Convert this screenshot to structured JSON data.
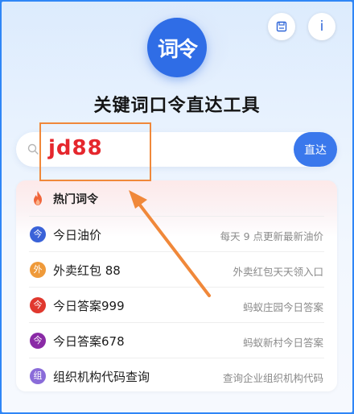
{
  "logo": {
    "text": "词令"
  },
  "top_buttons": {
    "save_icon": "save-icon",
    "info_label": "i"
  },
  "title": "关键词口令直达工具",
  "search": {
    "value": "jd88",
    "icon": "search-icon",
    "go_label": "直达"
  },
  "hot": {
    "title": "热门词令",
    "icon": "fire-icon",
    "accent": "#f0883a",
    "items": [
      {
        "badge": "今",
        "badge_color": "#3a62d8",
        "name": "今日油价",
        "desc": "每天 9 点更新最新油价"
      },
      {
        "badge": "外",
        "badge_color": "#ef9a3a",
        "name": "外卖红包 88",
        "desc": "外卖红包天天领入口"
      },
      {
        "badge": "今",
        "badge_color": "#e0382e",
        "name": "今日答案999",
        "desc": "蚂蚁庄园今日答案"
      },
      {
        "badge": "今",
        "badge_color": "#8a2aa6",
        "name": "今日答案678",
        "desc": "蚂蚁新村今日答案"
      },
      {
        "badge": "组",
        "badge_color": "#8a6cd9",
        "name": "组织机构代码查询",
        "desc": "查询企业组织机构代码"
      }
    ]
  },
  "colors": {
    "primary": "#2f6de6",
    "frame": "#2f86f6",
    "highlight": "#f0883a",
    "search_text": "#e5272d"
  }
}
